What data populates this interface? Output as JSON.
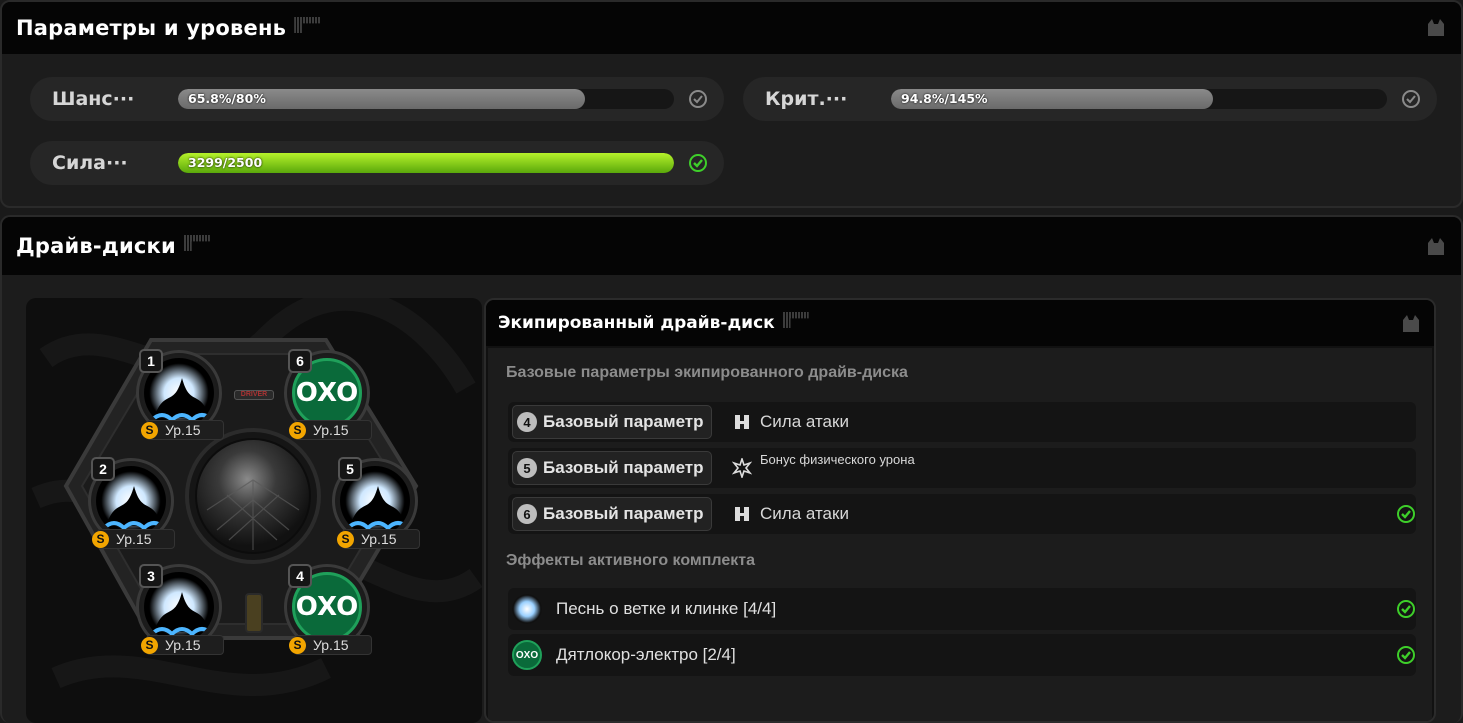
{
  "params_panel": {
    "title": "Параметры и уровень",
    "stats": [
      {
        "label": "Шанс···",
        "value_text": "65.8%/80%",
        "progress": 0.8225,
        "met": false
      },
      {
        "label": "Крит.···",
        "value_text": "94.8%/145%",
        "progress": 0.654,
        "met": false
      },
      {
        "label": "Сила···",
        "value_text": "3299/2500",
        "progress": 1.0,
        "met": true
      }
    ]
  },
  "drive_panel": {
    "title": "Драйв-диски",
    "slots": [
      {
        "num": "1",
        "level": "Ур.15",
        "set": "storm"
      },
      {
        "num": "2",
        "level": "Ур.15",
        "set": "storm"
      },
      {
        "num": "3",
        "level": "Ур.15",
        "set": "storm"
      },
      {
        "num": "4",
        "level": "Ур.15",
        "set": "oxo"
      },
      {
        "num": "5",
        "level": "Ур.15",
        "set": "storm"
      },
      {
        "num": "6",
        "level": "Ур.15",
        "set": "oxo"
      }
    ],
    "driver_label": "DRIVER",
    "oxo_text": "OXO"
  },
  "equipped": {
    "title": "Экипированный драйв-диск",
    "base_title": "Базовые параметры экипированного драйв-диска",
    "base_rows": [
      {
        "num": "4",
        "chip": "Базовый параметр",
        "stat": "Сила атаки",
        "icon": "attack-icon",
        "met": false
      },
      {
        "num": "5",
        "chip": "Базовый параметр",
        "stat": "Бонус физического урона",
        "icon": "physical-icon",
        "met": false
      },
      {
        "num": "6",
        "chip": "Базовый параметр",
        "stat": "Сила атаки",
        "icon": "attack-icon",
        "met": true
      }
    ],
    "set_title": "Эффекты активного комплекта",
    "sets": [
      {
        "name": "Песнь о ветке и клинке [4/4]",
        "icon": "storm-set-icon",
        "met": true
      },
      {
        "name": "Дятлокор-электро [2/4]",
        "icon": "oxo-set-icon",
        "met": true
      }
    ]
  },
  "colors": {
    "accent_green": "#3ecf2a",
    "bar_green": "#8fd812",
    "bar_grey": "#7a7a7a",
    "coin": "#f2a500"
  }
}
